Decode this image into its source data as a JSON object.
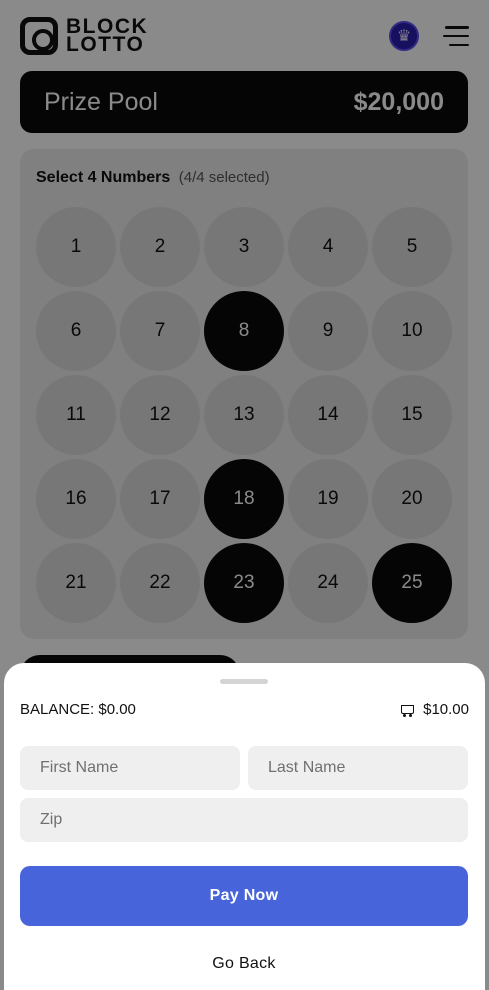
{
  "app": {
    "logo_line1": "BLOCK",
    "logo_line2": "LOTTO"
  },
  "prize_pool": {
    "label": "Prize Pool",
    "amount": "$20,000"
  },
  "picker": {
    "title": "Select 4 Numbers",
    "status": "(4/4 selected)",
    "numbers": [
      "1",
      "2",
      "3",
      "4",
      "5",
      "6",
      "7",
      "8",
      "9",
      "10",
      "11",
      "12",
      "13",
      "14",
      "15",
      "16",
      "17",
      "18",
      "19",
      "20",
      "21",
      "22",
      "23",
      "24",
      "25"
    ],
    "selected": [
      "8",
      "18",
      "23",
      "25"
    ]
  },
  "sheet": {
    "balance": "BALANCE: $0.00",
    "cart_total": "$10.00",
    "first_name_placeholder": "First Name",
    "last_name_placeholder": "Last Name",
    "zip_placeholder": "Zip",
    "pay_label": "Pay Now",
    "back_label": "Go Back"
  },
  "colors": {
    "accent": "#4864db",
    "selected_number": "#0b0b0b",
    "avatar": "#2a1fb0"
  },
  "icons": {
    "logo": "block-lotto-logo-icon",
    "avatar": "avatar-icon",
    "menu": "hamburger-menu-icon",
    "cart": "cart-icon"
  }
}
